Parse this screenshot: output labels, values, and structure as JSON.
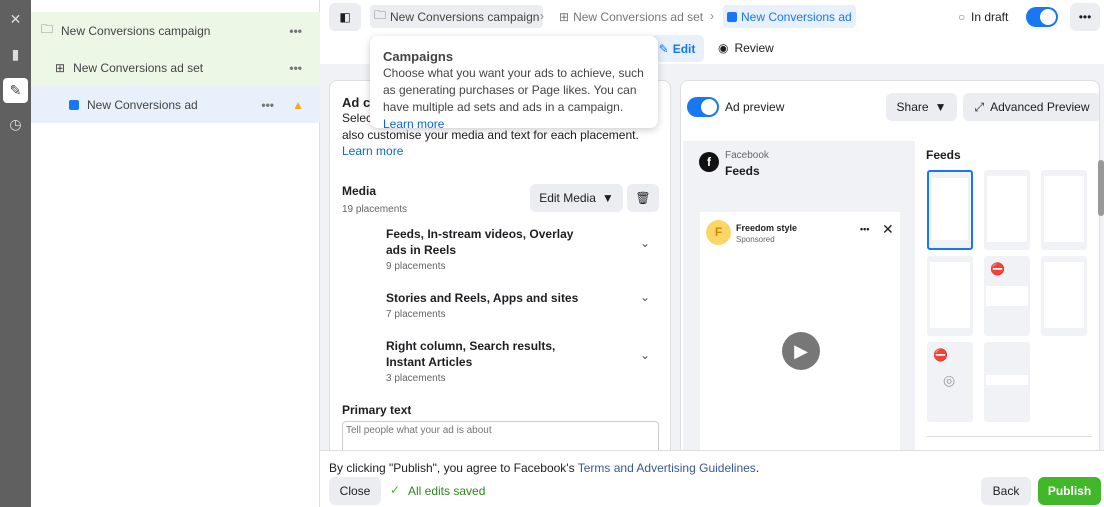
{
  "rail": {
    "icons": [
      "close-icon",
      "chart-icon",
      "pencil-icon",
      "clock-icon"
    ]
  },
  "tree": [
    {
      "label": "New Conversions campaign"
    },
    {
      "label": "New Conversions ad set"
    },
    {
      "label": "New Conversions ad"
    }
  ],
  "breadcrumb": [
    "New Conversions campaign",
    "New Conversions ad set",
    "New Conversions ad"
  ],
  "status": "In draft",
  "tabs": {
    "edit": "Edit",
    "review": "Review"
  },
  "tooltip": {
    "title": "Campaigns",
    "body": "Choose what you want your ads to achieve, such as generating purchases or Page likes. You can have multiple ad sets and ads in a campaign.",
    "link": "Learn more"
  },
  "creative": {
    "title": "Ad creative",
    "desc_line1": "Select",
    "desc_rest": "also customise your media and text for each placement.",
    "link": "Learn more",
    "media_label": "Media",
    "media_count": "19 placements",
    "edit_media": "Edit Media",
    "placements": [
      {
        "name": "Feeds, In-stream videos, Overlay ads in Reels",
        "count": "9 placements"
      },
      {
        "name": "Stories and Reels, Apps and sites",
        "count": "7 placements"
      },
      {
        "name": "Right column, Search results, Instant Articles",
        "count": "3 placements"
      }
    ],
    "primary_text_label": "Primary text",
    "primary_text_placeholder": "Tell people what your ad is about"
  },
  "preview": {
    "toggle_label": "Ad preview",
    "share": "Share",
    "advanced": "Advanced Preview",
    "platform": "Facebook",
    "placement": "Feeds",
    "page_name": "Freedom style",
    "sponsored": "Sponsored",
    "avatar_letter": "F",
    "feeds_title": "Feeds"
  },
  "footer": {
    "notice_prefix": "By clicking \"Publish\", you agree to Facebook's ",
    "notice_link": "Terms and Advertising Guidelines",
    "notice_suffix": ".",
    "close": "Close",
    "saved": "All edits saved",
    "back": "Back",
    "publish": "Publish"
  },
  "colors": {
    "accent": "#1877f2",
    "publish": "#42b72a",
    "warning": "#f5a623"
  }
}
